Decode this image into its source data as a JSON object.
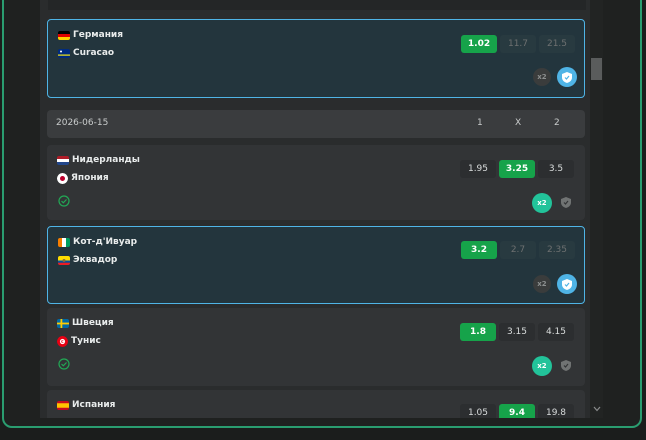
{
  "date_header": {
    "date": "2026-06-15",
    "col1": "1",
    "colx": "X",
    "col2": "2"
  },
  "matches": [
    {
      "team1": "Германия",
      "team2": "Curacao",
      "odds": [
        "1.02",
        "11.7",
        "21.5"
      ],
      "selected": true
    },
    {
      "team1": "Нидерланды",
      "team2": "Япония",
      "odds": [
        "1.95",
        "3.25",
        "3.5"
      ],
      "selected": false
    },
    {
      "team1": "Кот-д'Ивуар",
      "team2": "Эквадор",
      "odds": [
        "3.2",
        "2.7",
        "2.35"
      ],
      "selected": true
    },
    {
      "team1": "Швеция",
      "team2": "Тунис",
      "odds": [
        "1.8",
        "3.15",
        "4.15"
      ],
      "selected": false
    },
    {
      "team1": "Испания",
      "team2": "",
      "odds": [
        "1.05",
        "9.4",
        "19.8"
      ],
      "selected": false
    }
  ],
  "badges": {
    "x2": "x2"
  },
  "colors": {
    "accent_green": "#16a34a",
    "accent_blue": "#4fb4e6",
    "teal": "#22c39a"
  }
}
